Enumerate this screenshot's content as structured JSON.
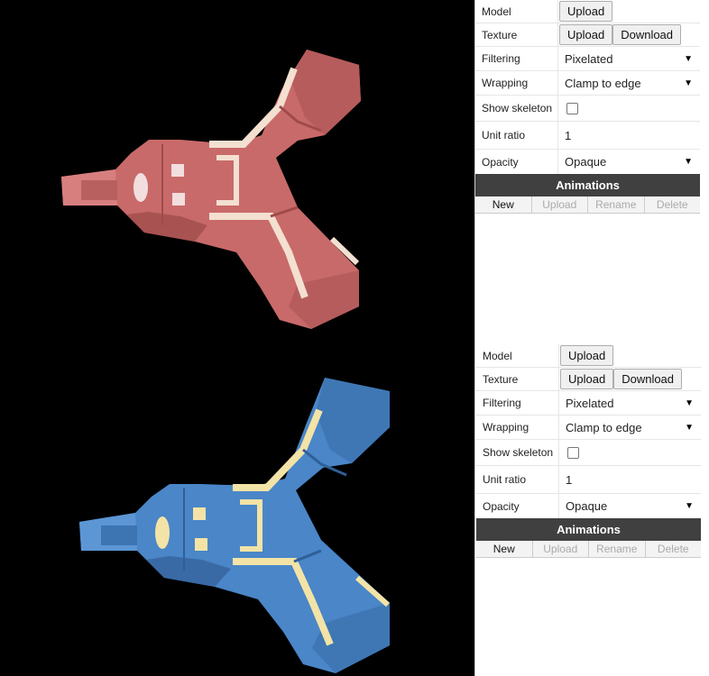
{
  "instances": [
    {
      "model_color": "#c96a6a",
      "panel": {
        "model": {
          "label": "Model",
          "upload": "Upload"
        },
        "texture": {
          "label": "Texture",
          "upload": "Upload",
          "download": "Download"
        },
        "filtering": {
          "label": "Filtering",
          "value": "Pixelated"
        },
        "wrapping": {
          "label": "Wrapping",
          "value": "Clamp to edge"
        },
        "show_skeleton": {
          "label": "Show skeleton",
          "checked": false
        },
        "unit_ratio": {
          "label": "Unit ratio",
          "value": "1"
        },
        "opacity": {
          "label": "Opacity",
          "value": "Opaque"
        },
        "animations": {
          "title": "Animations",
          "buttons": {
            "new": "New",
            "upload": "Upload",
            "rename": "Rename",
            "delete": "Delete"
          }
        }
      }
    },
    {
      "model_color": "#4a86c8",
      "panel": {
        "model": {
          "label": "Model",
          "upload": "Upload"
        },
        "texture": {
          "label": "Texture",
          "upload": "Upload",
          "download": "Download"
        },
        "filtering": {
          "label": "Filtering",
          "value": "Pixelated"
        },
        "wrapping": {
          "label": "Wrapping",
          "value": "Clamp to edge"
        },
        "show_skeleton": {
          "label": "Show skeleton",
          "checked": false
        },
        "unit_ratio": {
          "label": "Unit ratio",
          "value": "1"
        },
        "opacity": {
          "label": "Opacity",
          "value": "Opaque"
        },
        "animations": {
          "title": "Animations",
          "buttons": {
            "new": "New",
            "upload": "Upload",
            "rename": "Rename",
            "delete": "Delete"
          }
        }
      }
    }
  ]
}
